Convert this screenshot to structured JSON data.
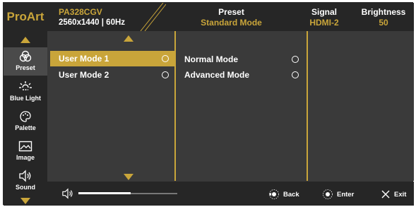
{
  "header": {
    "brand": "ProArt",
    "model": "PA328CGV",
    "resolution": "2560x1440 | 60Hz",
    "preset_label": "Preset",
    "preset_value": "Standard Mode",
    "signal_label": "Signal",
    "signal_value": "HDMI-2",
    "brightness_label": "Brightness",
    "brightness_value": "50"
  },
  "sidebar": {
    "items": [
      {
        "label": "Preset",
        "icon": "preset-icon",
        "active": true
      },
      {
        "label": "Blue Light",
        "icon": "blue-light-icon",
        "active": false
      },
      {
        "label": "Palette",
        "icon": "palette-icon",
        "active": false
      },
      {
        "label": "Image",
        "icon": "image-icon",
        "active": false
      },
      {
        "label": "Sound",
        "icon": "sound-icon",
        "active": false
      }
    ]
  },
  "panel1": {
    "options": [
      {
        "label": "User Mode 1",
        "selected": true
      },
      {
        "label": "User Mode 2",
        "selected": false
      }
    ]
  },
  "panel2": {
    "options": [
      {
        "label": "Normal Mode",
        "selected": false
      },
      {
        "label": "Advanced Mode",
        "selected": false
      }
    ]
  },
  "bottom": {
    "volume_level": 0.53,
    "back_label": "Back",
    "enter_label": "Enter",
    "exit_label": "Exit"
  },
  "colors": {
    "accent": "#c9a53a",
    "header_bg": "#262626",
    "panel_bg": "#3a3a3a"
  }
}
